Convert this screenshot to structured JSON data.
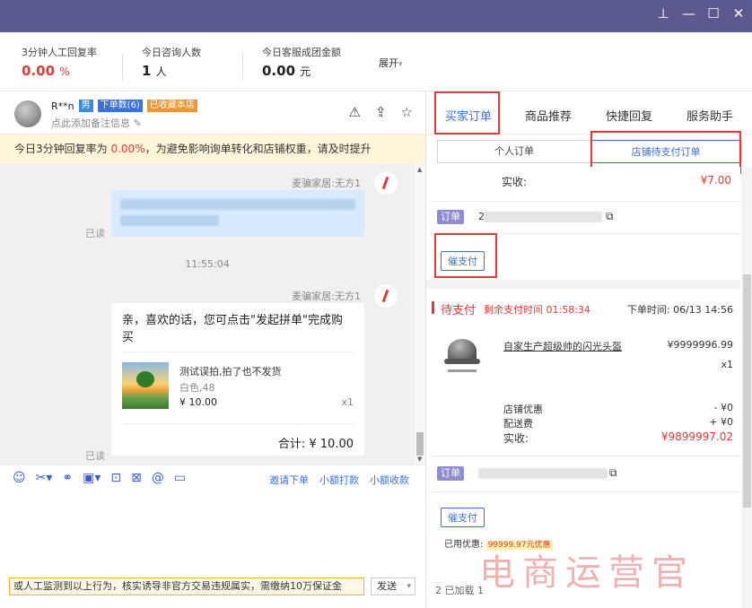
{
  "window": {
    "pin": "⊥",
    "minimize": "—",
    "maximize": "☐",
    "close": "✕"
  },
  "stats": [
    {
      "label": "3分钟人工回复率",
      "value": "0.00",
      "unit": "%"
    },
    {
      "label": "今日咨询人数",
      "value": "1",
      "unit": "人"
    },
    {
      "label": "今日客服成团金额",
      "value": "0.00",
      "unit": "元"
    }
  ],
  "expand_label": "展开",
  "expand_caret": "▾",
  "chat_header": {
    "name": "R**n",
    "gender_tag": "男",
    "orders_tag": "下单数(6)",
    "fav_tag": "已收藏本店",
    "remark": "点此添加备注信息",
    "remark_edit_icon": "✎",
    "icons": {
      "warn": "⚠",
      "share": "⇪",
      "star": "☆"
    }
  },
  "notice": {
    "pre": "今日3分钟回复率为",
    "rate": "0.00%",
    "post": "，为避免影响询单转化和店铺权重，请及时提升"
  },
  "chat": {
    "sender1": "麦骗家居:无方1",
    "read1": "已读",
    "timestamp": "11:55:04",
    "sender2": "麦骗家居:无方1",
    "message": "亲，喜欢的话，您可点击\"发起拼单\"完成购买",
    "product_name": "测试误拍,拍了也不发货",
    "product_spec": "白色,48",
    "product_price": "¥ 10.00",
    "product_qty": "x1",
    "total": "合计: ¥ 10.00",
    "read2": "已读"
  },
  "scroll_arrows": {
    "up": "▲",
    "down": "▼"
  },
  "toolbar": {
    "icons": {
      "emoji": "☺",
      "scissors": "✂▾",
      "link": "⚭",
      "image": "▣▾",
      "screen": "⊡",
      "card": "⊠",
      "at": "@",
      "folder": "▭"
    },
    "links": [
      "邀请下单",
      "小额打款",
      "小额收款"
    ]
  },
  "input": {
    "warning": "或人工监测到以上行为，核实诱导非官方交易违规属实，需缴纳10万保证金",
    "send": "发送",
    "send_caret": "▾"
  },
  "right_tabs": [
    "买家订单",
    "商品推荐",
    "快捷回复",
    "服务助手"
  ],
  "sub_tabs": [
    "个人订单",
    "店铺待支付订单"
  ],
  "order1": {
    "paid_label": "实收:",
    "paid_value": "¥7.00",
    "order_tag": "订单",
    "order_no_prefix": "2",
    "copy_icon": "⧉",
    "urge_btn": "催支付"
  },
  "order2": {
    "status": "待支付",
    "remain": "剩余支付时间 01:58:34",
    "order_time": "下单时间: 06/13 14:56",
    "product_name": "自家生产超级帅的闪光头盔",
    "price": "¥9999996.99",
    "qty": "x1",
    "rows": [
      {
        "k": "店铺优惠",
        "v": "- ¥0"
      },
      {
        "k": "配送费",
        "v": "+ ¥0"
      }
    ],
    "paid_label": "实收:",
    "paid_value": "¥9899997.02",
    "order_tag": "订单",
    "copy_icon": "⧉",
    "urge_btn": "催支付",
    "used_label": "已用优惠:",
    "used_value": "99999.97元优惠"
  },
  "pager": "2  已加载  1",
  "watermark": "电商运营官"
}
